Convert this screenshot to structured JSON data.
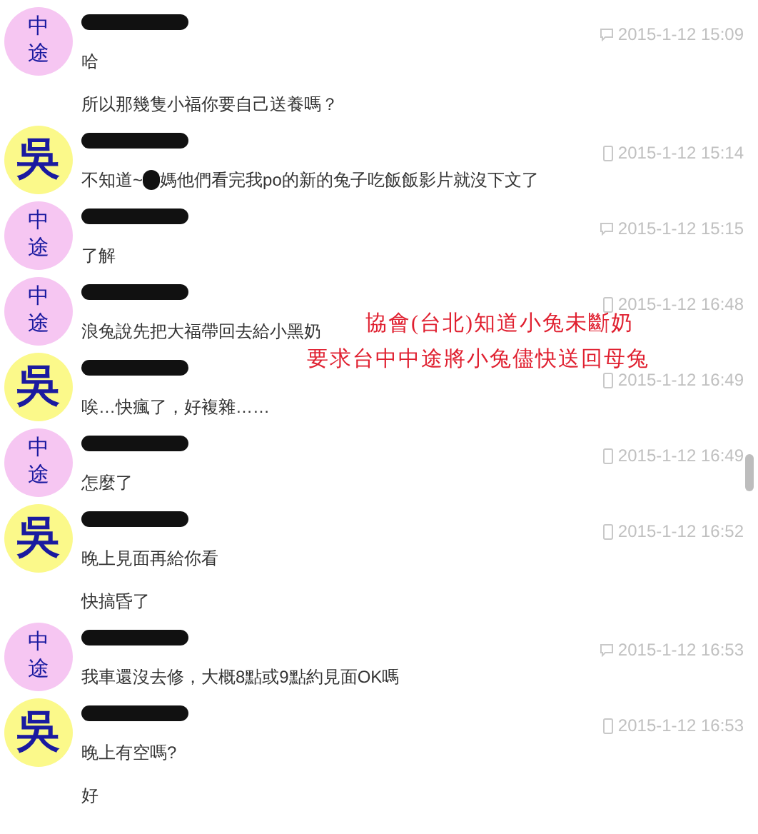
{
  "messages": [
    {
      "avatar": {
        "text": "中途",
        "color": "#f6c6f2"
      },
      "kind": "web",
      "time": "2015-1-12 15:09",
      "lines": [
        {
          "text": "哈"
        },
        {
          "text": "所以那幾隻小福你要自己送養嗎？"
        }
      ]
    },
    {
      "avatar": {
        "text": "吳",
        "color": "#fbf98a"
      },
      "kind": "mobile",
      "time": "2015-1-12 15:14",
      "lines": [
        {
          "before": "不知道~",
          "after": "媽他們看完我po的新的兔子吃飯飯影片就沒下文了"
        }
      ]
    },
    {
      "avatar": {
        "text": "中途",
        "color": "#f6c6f2"
      },
      "kind": "web",
      "time": "2015-1-12 15:15",
      "lines": [
        {
          "text": "了解"
        }
      ]
    },
    {
      "avatar": {
        "text": "中途",
        "color": "#f6c6f2"
      },
      "kind": "mobile",
      "time": "2015-1-12 16:48",
      "lines": [
        {
          "text": "浪兔說先把大福帶回去給小黑奶"
        }
      ]
    },
    {
      "avatar": {
        "text": "吳",
        "color": "#fbf98a"
      },
      "kind": "mobile",
      "time": "2015-1-12 16:49",
      "lines": [
        {
          "text": "唉…快瘋了，好複雜……"
        }
      ]
    },
    {
      "avatar": {
        "text": "中途",
        "color": "#f6c6f2"
      },
      "kind": "mobile",
      "time": "2015-1-12 16:49",
      "lines": [
        {
          "text": "怎麼了"
        }
      ]
    },
    {
      "avatar": {
        "text": "吳",
        "color": "#fbf98a"
      },
      "kind": "mobile",
      "time": "2015-1-12 16:52",
      "lines": [
        {
          "text": "晚上見面再給你看"
        },
        {
          "text": "快搞昏了"
        }
      ]
    },
    {
      "avatar": {
        "text": "中途",
        "color": "#f6c6f2"
      },
      "kind": "web",
      "time": "2015-1-12 16:53",
      "lines": [
        {
          "text": "我車還沒去修，大概8點或9點約見面OK嗎"
        }
      ]
    },
    {
      "avatar": {
        "text": "吳",
        "color": "#fbf98a"
      },
      "kind": "mobile",
      "time": "2015-1-12 16:53",
      "lines": [
        {
          "text": "晚上有空嗎?"
        },
        {
          "text": "好"
        }
      ]
    }
  ],
  "annotation": [
    "協會(台北)知道小兔未斷奶",
    "要求台中中途將小兔儘快送回母兔"
  ]
}
